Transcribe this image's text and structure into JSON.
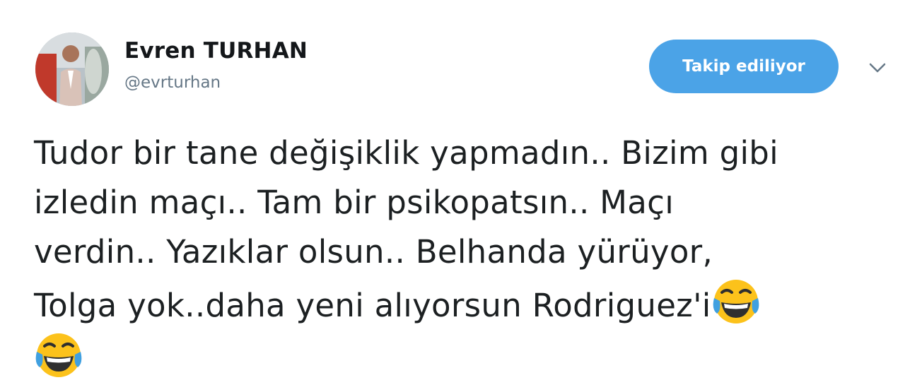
{
  "author": {
    "name": "Evren TURHAN",
    "handle": "@evrturhan",
    "avatar_icon": "profile-photo"
  },
  "actions": {
    "follow_label": "Takip ediliyor",
    "menu_icon": "chevron-down-icon"
  },
  "colors": {
    "follow_button": "#4ba3e7",
    "handle_text": "#657786",
    "body_text": "#1c2022",
    "emoji_face": "#fcc21b"
  },
  "tweet": {
    "lines": [
      "Tudor bir tane değişiklik yapmadın.. Bizim gibi",
      "izledin maçı.. Tam bir psikopatsın.. Maçı",
      "verdin.. Yazıklar olsun.. Belhanda yürüyor,",
      "Tolga yok..daha yeni alıyorsun Rodriguez'i"
    ],
    "emoji_icon": "face-with-tears-of-joy-icon"
  }
}
